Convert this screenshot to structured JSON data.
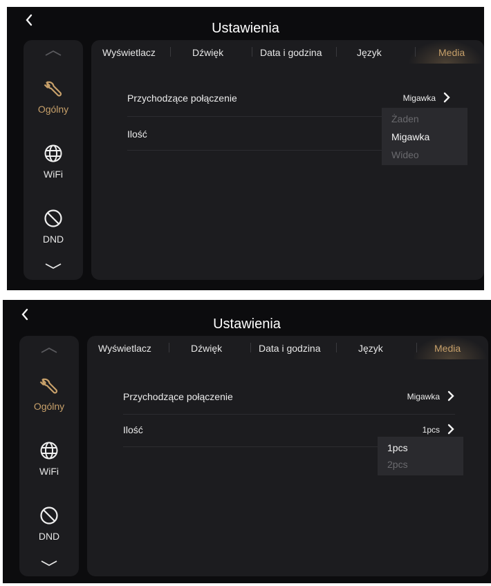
{
  "colors": {
    "accent": "#c7a06a",
    "background": "#0c0c0e",
    "panel": "#1c1c1f"
  },
  "screens": [
    {
      "back_icon": "chevron-left-icon",
      "title": "Ustawienia",
      "sidebar": {
        "up_icon": "chevron-up-icon",
        "down_icon": "chevron-down-icon",
        "items": [
          {
            "label": "Ogólny",
            "icon": "wrench-icon",
            "active": true
          },
          {
            "label": "WiFi",
            "icon": "globe-icon",
            "active": false
          },
          {
            "label": "DND",
            "icon": "do-not-disturb-icon",
            "active": false
          }
        ]
      },
      "tabs": [
        "Wyświetlacz",
        "Dźwięk",
        "Data i godzina",
        "Język",
        "Media"
      ],
      "active_tab": "Media",
      "rows": [
        {
          "label": "Przychodzące połączenie",
          "value": "Migawka"
        },
        {
          "label": "Ilość",
          "value": ""
        }
      ],
      "dropdown": {
        "options": [
          "Żaden",
          "Migawka",
          "Wideo"
        ],
        "selected": "Migawka"
      }
    },
    {
      "back_icon": "chevron-left-icon",
      "title": "Ustawienia",
      "sidebar": {
        "up_icon": "chevron-up-icon",
        "down_icon": "chevron-down-icon",
        "items": [
          {
            "label": "Ogólny",
            "icon": "wrench-icon",
            "active": true
          },
          {
            "label": "WiFi",
            "icon": "globe-icon",
            "active": false
          },
          {
            "label": "DND",
            "icon": "do-not-disturb-icon",
            "active": false
          }
        ]
      },
      "tabs": [
        "Wyświetlacz",
        "Dźwięk",
        "Data i godzina",
        "Język",
        "Media"
      ],
      "active_tab": "Media",
      "rows": [
        {
          "label": "Przychodzące połączenie",
          "value": "Migawka"
        },
        {
          "label": "Ilość",
          "value": "1pcs"
        }
      ],
      "dropdown": {
        "options": [
          "1pcs",
          "2pcs"
        ],
        "selected": "1pcs"
      }
    }
  ]
}
